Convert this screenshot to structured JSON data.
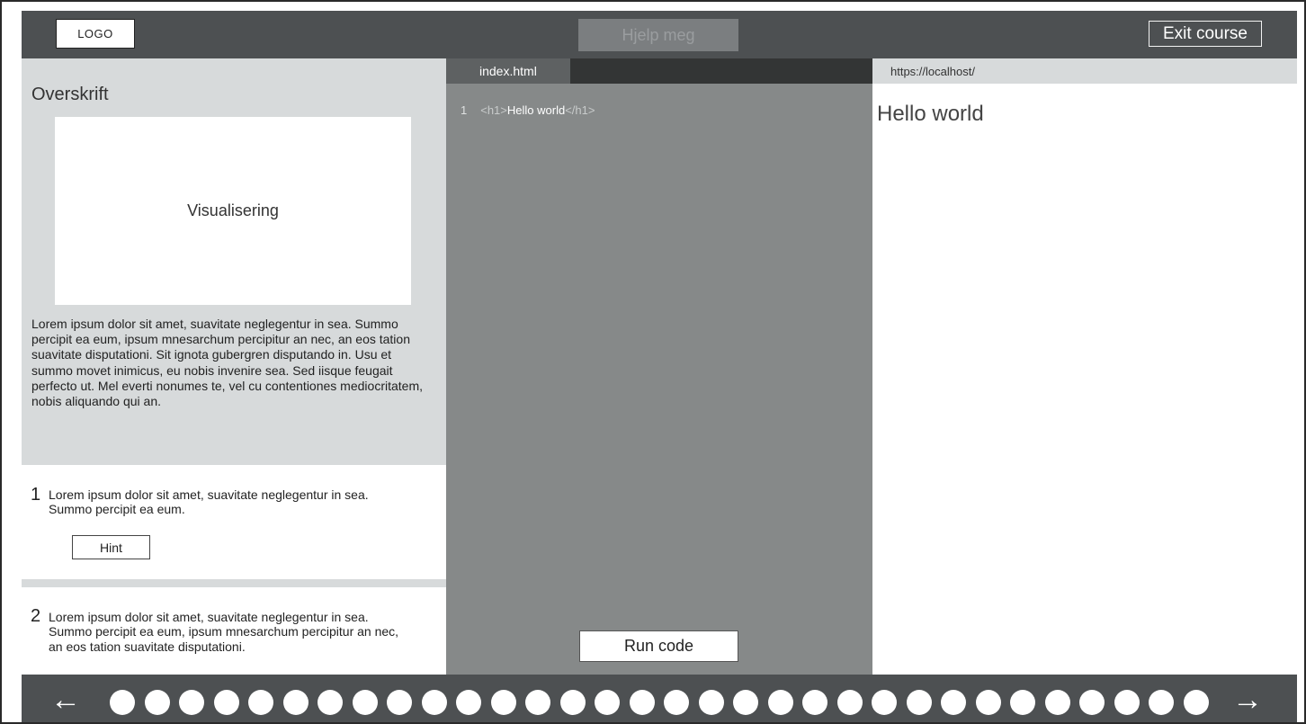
{
  "header": {
    "logo": "LOGO",
    "help_label": "Hjelp meg",
    "exit_label": "Exit course"
  },
  "lesson": {
    "heading": "Overskrift",
    "visual_label": "Visualisering",
    "intro_text": "Lorem ipsum dolor sit amet, suavitate neglegentur in sea. Summo percipit ea eum, ipsum mnesarchum percipitur an nec, an eos tation suavitate disputationi. Sit ignota gubergren disputando in. Usu et summo movet inimicus, eu nobis invenire sea. Sed iisque feugait perfecto ut. Mel everti nonumes te, vel cu contentiones mediocritatem, nobis aliquando qui an.",
    "tasks": [
      {
        "number": "1",
        "text": "Lorem ipsum dolor sit amet, suavitate neglegentur in sea. Summo percipit ea eum.",
        "hint_label": "Hint"
      },
      {
        "number": "2",
        "text": "Lorem ipsum dolor sit amet, suavitate neglegentur in sea. Summo percipit ea eum, ipsum mnesarchum percipitur an nec, an eos tation suavitate disputationi."
      }
    ]
  },
  "editor": {
    "tab_label": "index.html",
    "lines": [
      {
        "number": "1",
        "open_tag": "<h1>",
        "text": "Hello world",
        "close_tag": "</h1>"
      }
    ],
    "run_label": "Run code"
  },
  "preview": {
    "url": "https://localhost/",
    "heading": "Hello world"
  },
  "footer": {
    "prev_icon": "arrow-left-icon",
    "next_icon": "arrow-right-icon",
    "prev_glyph": "←",
    "next_glyph": "→",
    "step_count": 32
  }
}
